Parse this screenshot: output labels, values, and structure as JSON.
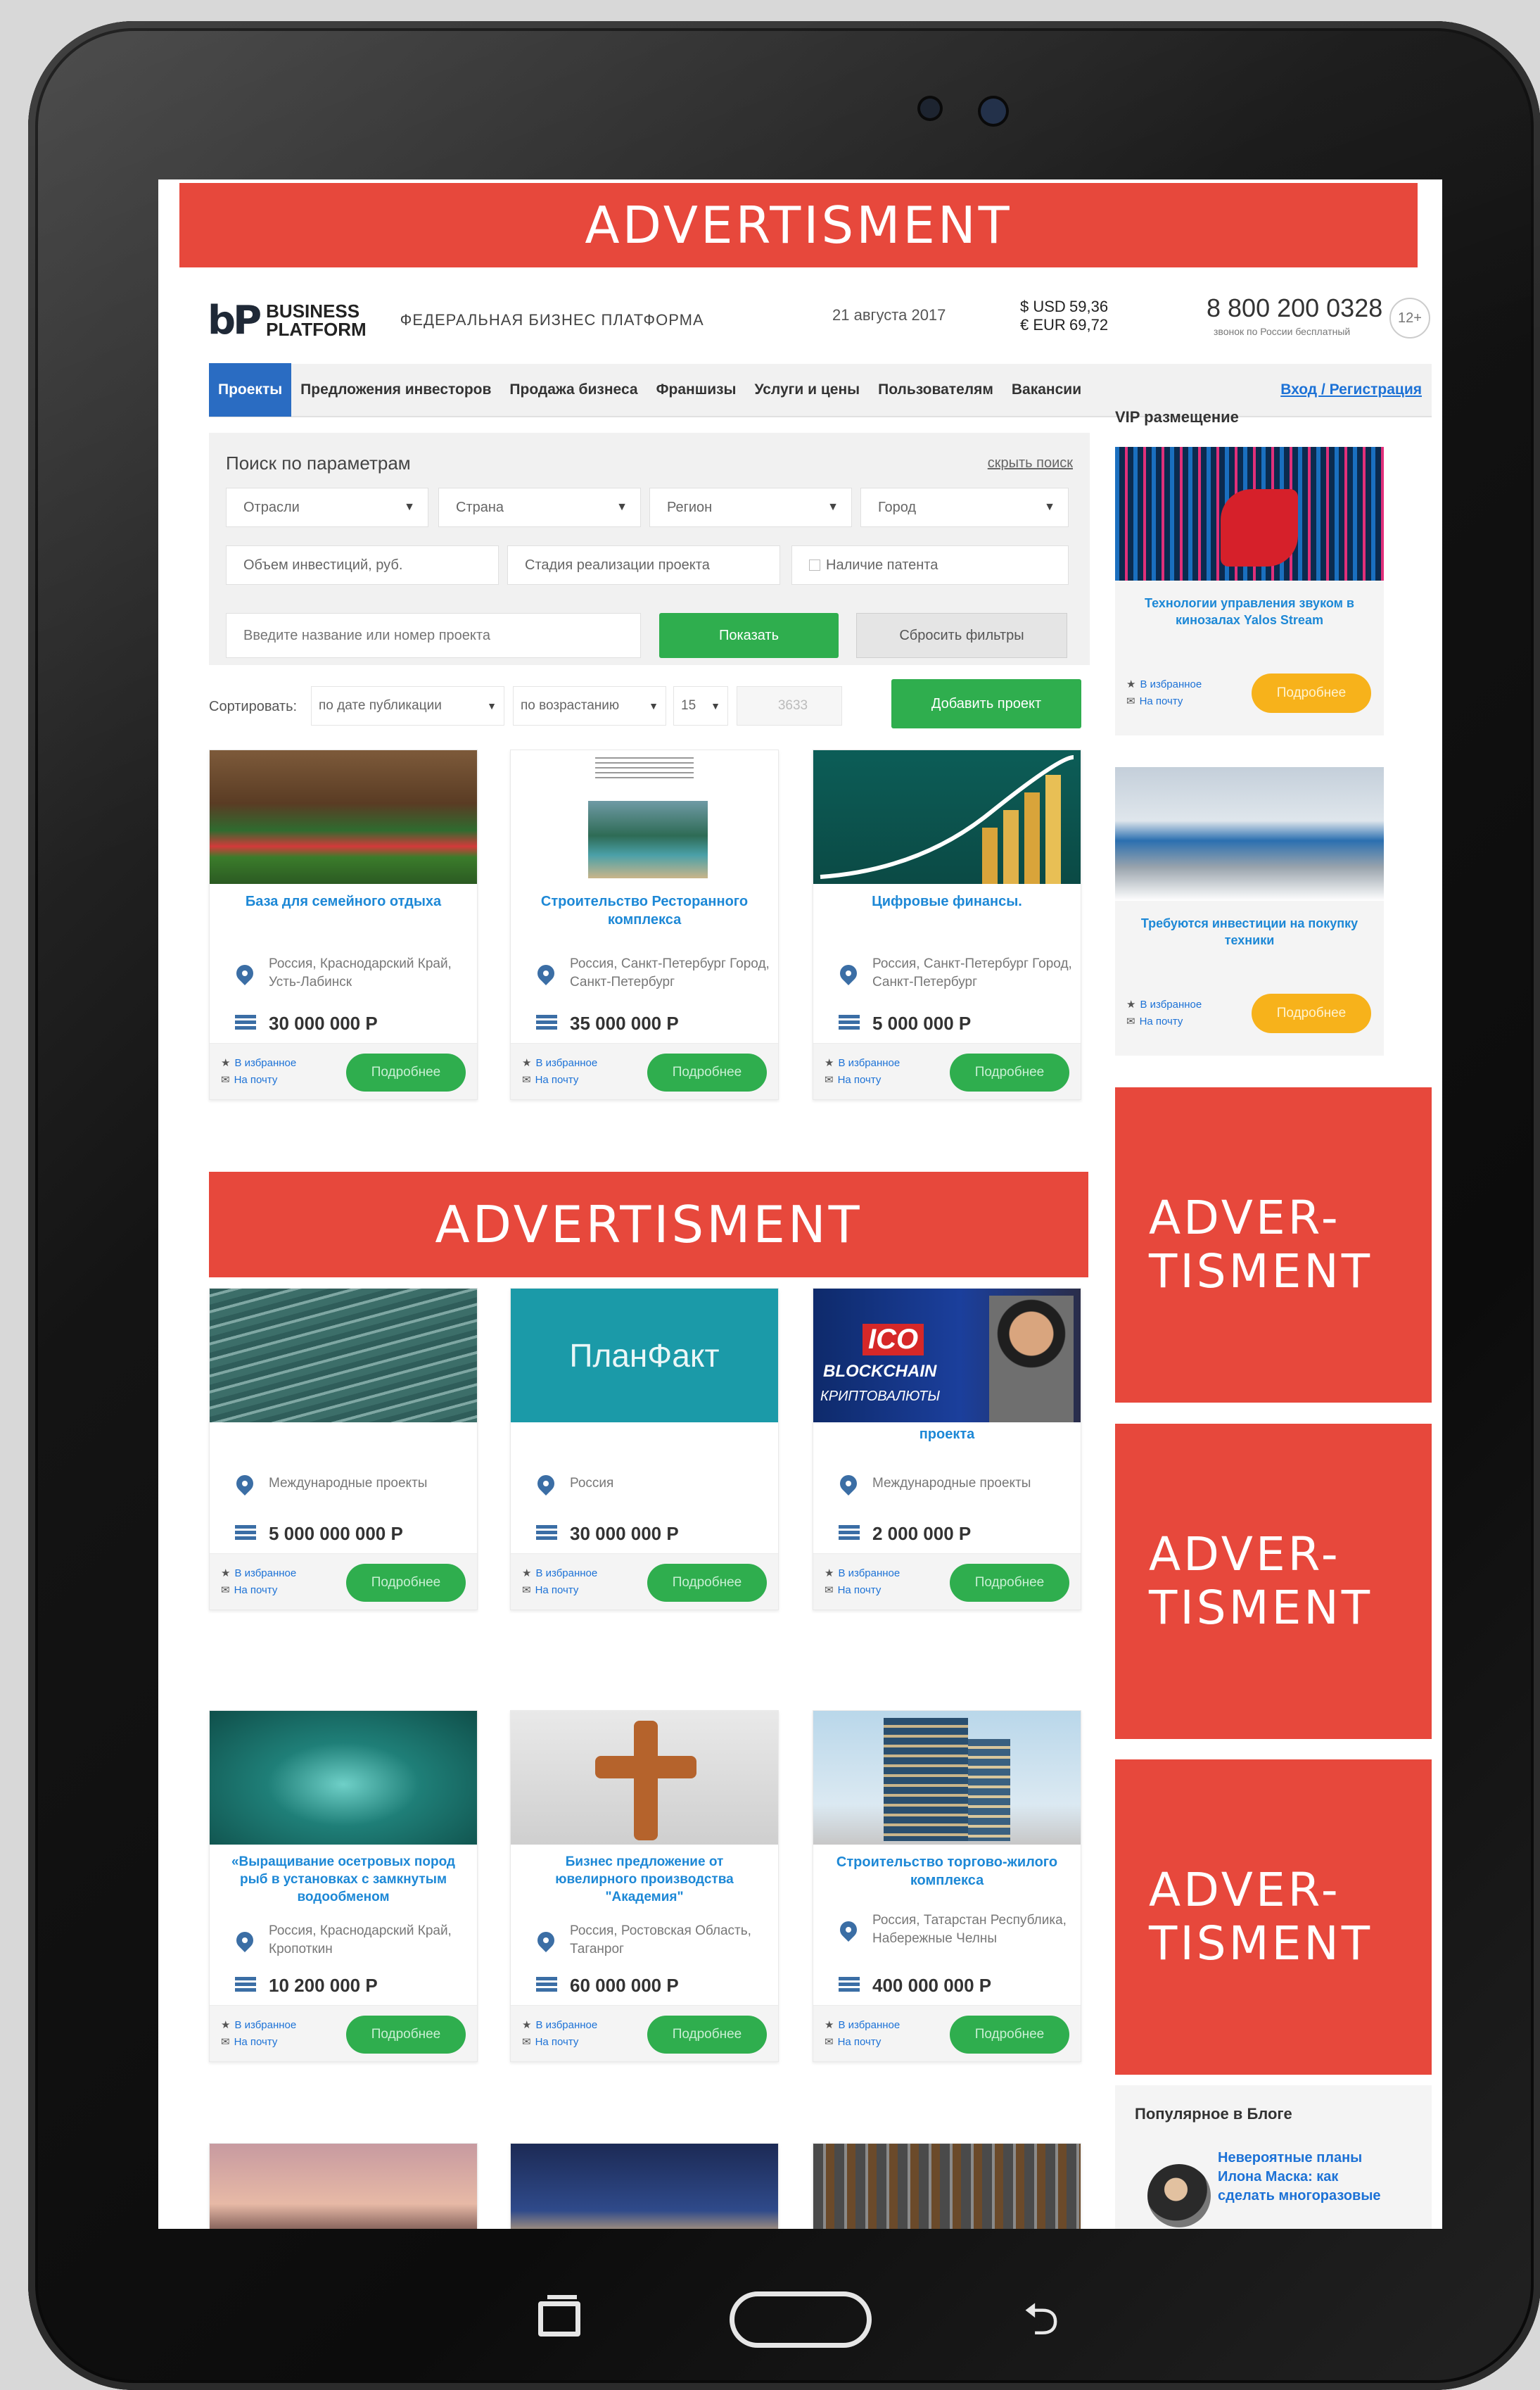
{
  "ads": {
    "top": "ADVERTISMENT",
    "middle": "ADVERTISMENT",
    "side_1": "ADVER-\nTISMENT",
    "side_2": "ADVER-\nTISMENT",
    "side_3": "ADVER-\nTISMENT"
  },
  "header": {
    "logo_mark": "bP",
    "logo_line1": "BUSINESS",
    "logo_line2": "PLATFORM",
    "tagline": "ФЕДЕРАЛЬНАЯ БИЗНЕС ПЛАТФОРМА",
    "date": "21 августа 2017",
    "usd_label": "$ USD",
    "usd_value": "59,36",
    "eur_label": "€ EUR",
    "eur_value": "69,72",
    "phone": "8 800 200 0328",
    "phone_sub": "звонок по России бесплатный",
    "age": "12+"
  },
  "nav": {
    "items": [
      "Проекты",
      "Предложения инвесторов",
      "Продажа бизнеса",
      "Франшизы",
      "Услуги и цены",
      "Пользователям",
      "Вакансии"
    ],
    "login": "Вход / Регистрация"
  },
  "search": {
    "title": "Поиск по параметрам",
    "hide": "скрыть поиск",
    "industry": "Отрасли",
    "country": "Страна",
    "region": "Регион",
    "city": "Город",
    "investment": "Объем инвестиций, руб.",
    "stage": "Стадия реализации проекта",
    "patent": "Наличие патента",
    "name_placeholder": "Введите название или номер проекта",
    "show": "Показать",
    "reset": "Сбросить фильтры"
  },
  "sort": {
    "label": "Сортировать:",
    "by": "по дате публикации",
    "order": "по возрастанию",
    "per_page": "15",
    "count": "3633",
    "add_project": "Добавить проект"
  },
  "card_labels": {
    "favorite": "В избранное",
    "mail": "На почту",
    "more": "Подробнее"
  },
  "projects": [
    {
      "title": "База для семейного отдыха",
      "location": "Россия, Краснодарский Край, Усть-Лабинск",
      "price": "30 000 000 Р"
    },
    {
      "title": "Строительство Ресторанного комплекса",
      "location": "Россия, Санкт-Петербург Город, Санкт-Петербург",
      "price": "35 000 000 Р"
    },
    {
      "title": "Цифровые финансы.",
      "location": "Россия, Санкт-Петербург Город, Санкт-Петербург",
      "price": "5 000 000 Р"
    },
    {
      "title": "",
      "location": "Международные проекты",
      "price": "5 000 000 000 Р"
    },
    {
      "title": "",
      "location": "Россия",
      "price": "30 000 000 Р",
      "image_text": "ПланФакт"
    },
    {
      "title": "проекта",
      "location": "Международные проекты",
      "price": "2 000 000 Р",
      "image_text": "ICO",
      "image_text2": "BLOCKCHAIN",
      "image_text3": "КРИПТОВАЛЮТЫ"
    },
    {
      "title": "«Выращивание осетровых пород рыб в установках с замкнутым водообменом",
      "location": "Россия, Краснодарский Край, Кропоткин",
      "price": "10 200 000 Р"
    },
    {
      "title": "Бизнес предложение от ювелирного производства \"Академия\"",
      "location": "Россия, Ростовская Область, Таганрог",
      "price": "60 000 000 Р"
    },
    {
      "title": "Строительство торгово-жилого комплекса",
      "location": "Россия, Татарстан Республика, Набережные Челны",
      "price": "400 000 000 Р"
    }
  ],
  "sidebar": {
    "title": "VIP размещение",
    "vip": [
      {
        "title": "Технологии управления звуком в кинозалах Yalos Stream",
        "more": "Подробнее"
      },
      {
        "title": "Требуются инвестиции на покупку техники",
        "more": "Подробнее"
      }
    ],
    "blog_title": "Популярное в Блоге",
    "blog_link": "Невероятные планы Илона Маска: как сделать многоразовые"
  },
  "colors": {
    "ad_red": "#e7483c",
    "green": "#2fae4e",
    "blue_link": "#1d88d6",
    "nav_active": "#2a6cc2",
    "vip_orange": "#f7b21b"
  }
}
